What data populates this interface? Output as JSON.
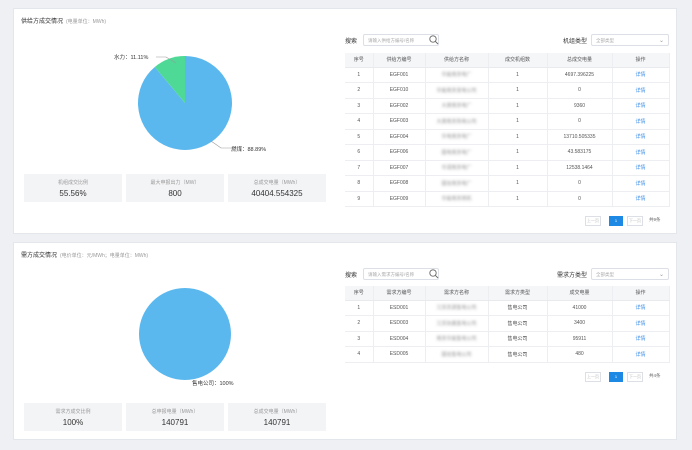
{
  "supply": {
    "title": "供给方成交情况",
    "subtitle": "(电量单位：MWh)",
    "pie": {
      "slices": [
        {
          "name": "燃煤",
          "percent": 88.89,
          "color": "#5bb8ee",
          "label": "燃煤：88.89%"
        },
        {
          "name": "水力",
          "percent": 11.11,
          "color": "#4fd996",
          "label": "水力：11.11%"
        }
      ]
    },
    "stats": [
      {
        "label": "机组成交比例",
        "value": "55.56%"
      },
      {
        "label": "最大申报出力（MW）",
        "value": "800"
      },
      {
        "label": "总成交电量（MWh）",
        "value": "40404.554325"
      }
    ],
    "filters": {
      "search_label": "搜索",
      "search_placeholder": "请输入供给方编号/名称",
      "type_label": "机组类型",
      "type_value": "全部类型"
    },
    "columns": [
      "序号",
      "供给方编号",
      "供给方名称",
      "成交机组数",
      "总成交电量",
      "操作"
    ],
    "rows": [
      [
        "1",
        "EGF001",
        "华能南京电厂",
        "1",
        "4697.396225",
        "详情"
      ],
      [
        "2",
        "EGF010",
        "华能南京发电公司",
        "1",
        "0",
        "详情"
      ],
      [
        "3",
        "EGF002",
        "大唐南京电厂",
        "1",
        "9360",
        "详情"
      ],
      [
        "4",
        "EGF003",
        "大唐南京热电公司",
        "1",
        "0",
        "详情"
      ],
      [
        "5",
        "EGF004",
        "华电南京电厂",
        "1",
        "13710.505335",
        "详情"
      ],
      [
        "6",
        "EGF006",
        "国电南京电厂",
        "1",
        "43.583175",
        "详情"
      ],
      [
        "7",
        "EGF007",
        "华润南京电厂",
        "1",
        "12538.1464",
        "详情"
      ],
      [
        "8",
        "EGF008",
        "国信南京电厂",
        "1",
        "0",
        "详情"
      ],
      [
        "9",
        "EGF009",
        "华能南京燃机",
        "1",
        "0",
        "详情"
      ]
    ],
    "pager": {
      "prev": "上一页",
      "current": "1",
      "next": "下一页",
      "total": "共9条"
    }
  },
  "demand": {
    "title": "需方成交情况",
    "subtitle": "(电价单位：元/MWh；电量单位：MWh)",
    "pie": {
      "slices": [
        {
          "name": "售电公司",
          "percent": 100,
          "color": "#5bb8ee",
          "label": "售电公司：100%"
        }
      ]
    },
    "stats": [
      {
        "label": "需求方成交比例",
        "value": "100%"
      },
      {
        "label": "总申报电量（MWh）",
        "value": "140791"
      },
      {
        "label": "总成交电量（MWh）",
        "value": "140791"
      }
    ],
    "filters": {
      "search_label": "搜索",
      "search_placeholder": "请输入需求方编号/名称",
      "type_label": "需求方类型",
      "type_value": "全部类型"
    },
    "columns": [
      "序号",
      "需求方编号",
      "需求方名称",
      "需求方类型",
      "成交电量",
      "操作"
    ],
    "rows": [
      [
        "1",
        "ESD001",
        "江苏苏源售电公司",
        "售电公司",
        "41000",
        "详情"
      ],
      [
        "2",
        "ESD003",
        "江苏协鑫售电公司",
        "售电公司",
        "3400",
        "详情"
      ],
      [
        "3",
        "ESD004",
        "南京华能售电公司",
        "售电公司",
        "95911",
        "详情"
      ],
      [
        "4",
        "ESD005",
        "国信售电公司",
        "售电公司",
        "480",
        "详情"
      ]
    ],
    "pager": {
      "prev": "上一页",
      "current": "1",
      "next": "下一页",
      "total": "共4条"
    }
  }
}
